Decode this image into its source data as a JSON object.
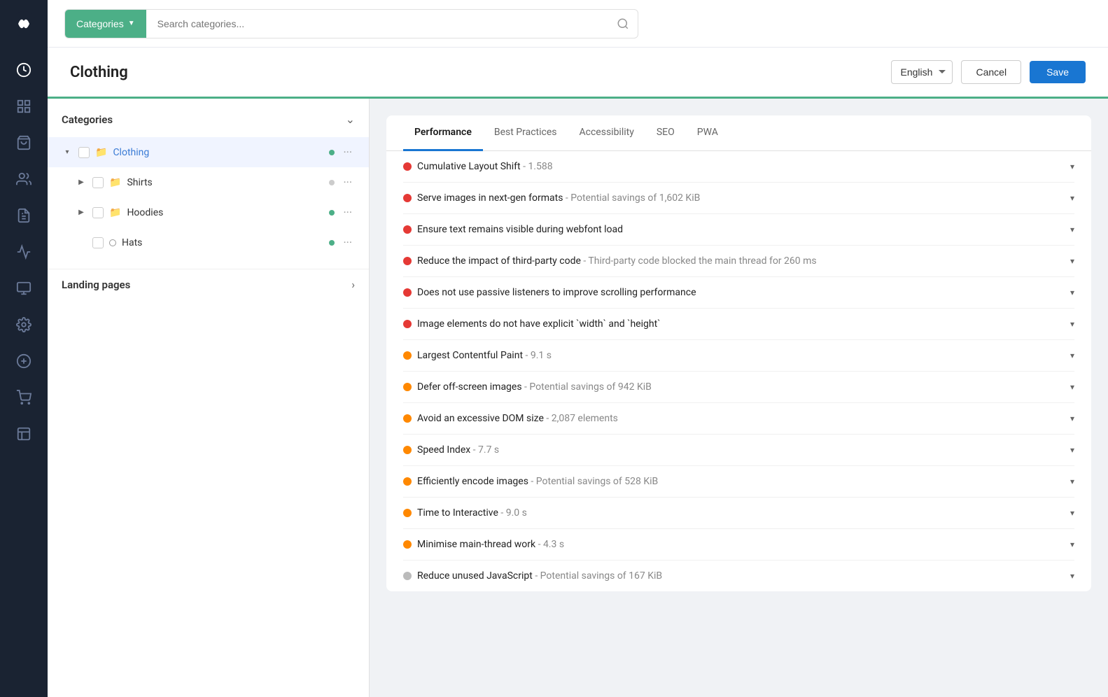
{
  "sidebar": {
    "logo_alt": "Ced Commerce Logo",
    "nav_items": [
      {
        "name": "dashboard",
        "icon": "chart-circle"
      },
      {
        "name": "catalog",
        "icon": "grid"
      },
      {
        "name": "products",
        "icon": "shopping-bag"
      },
      {
        "name": "users",
        "icon": "users"
      },
      {
        "name": "orders",
        "icon": "clipboard"
      },
      {
        "name": "promotions",
        "icon": "megaphone"
      },
      {
        "name": "integrations",
        "icon": "puzzle"
      },
      {
        "name": "settings",
        "icon": "gear"
      },
      {
        "name": "add",
        "icon": "plus-circle"
      },
      {
        "name": "cart",
        "icon": "cart"
      },
      {
        "name": "analytics",
        "icon": "bar-chart"
      }
    ]
  },
  "topbar": {
    "categories_btn": "Categories",
    "search_placeholder": "Search categories...",
    "search_icon": "search"
  },
  "page_header": {
    "title": "Clothing",
    "language": "English",
    "cancel_label": "Cancel",
    "save_label": "Save"
  },
  "left_panel": {
    "categories_section": "Categories",
    "tree": [
      {
        "label": "Clothing",
        "level": 0,
        "expanded": true,
        "is_folder": true,
        "status": "green",
        "selected": true
      },
      {
        "label": "Shirts",
        "level": 1,
        "expanded": false,
        "is_folder": true,
        "status": "gray",
        "selected": false
      },
      {
        "label": "Hoodies",
        "level": 1,
        "expanded": false,
        "is_folder": true,
        "status": "green",
        "selected": false
      },
      {
        "label": "Hats",
        "level": 1,
        "expanded": false,
        "is_folder": false,
        "status": "green",
        "selected": false
      }
    ],
    "landing_pages": "Landing pages"
  },
  "right_panel": {
    "tabs": [
      {
        "label": "Performance",
        "active": true
      },
      {
        "label": "Best Practices",
        "active": false
      },
      {
        "label": "Accessibility",
        "active": false
      },
      {
        "label": "SEO",
        "active": false
      },
      {
        "label": "PWA",
        "active": false
      }
    ],
    "metrics": [
      {
        "dot_color": "red",
        "text": "Cumulative Layout Shift",
        "detail": "- 1.588",
        "has_chevron": true
      },
      {
        "dot_color": "red",
        "text": "Serve images in next-gen formats",
        "detail": "- Potential savings of 1,602 KiB",
        "has_chevron": true
      },
      {
        "dot_color": "red",
        "text": "Ensure text remains visible during webfont load",
        "detail": "",
        "has_chevron": true
      },
      {
        "dot_color": "red",
        "text": "Reduce the impact of third-party code",
        "detail": "- Third-party code blocked the main thread for 260 ms",
        "has_chevron": true
      },
      {
        "dot_color": "red",
        "text": "Does not use passive listeners to improve scrolling performance",
        "detail": "",
        "has_chevron": true
      },
      {
        "dot_color": "red",
        "text": "Image elements do not have explicit `width` and `height`",
        "detail": "",
        "has_chevron": true
      },
      {
        "dot_color": "orange",
        "text": "Largest Contentful Paint",
        "detail": "- 9.1 s",
        "has_chevron": true
      },
      {
        "dot_color": "orange",
        "text": "Defer off-screen images",
        "detail": "- Potential savings of 942 KiB",
        "has_chevron": true
      },
      {
        "dot_color": "orange",
        "text": "Avoid an excessive DOM size",
        "detail": "- 2,087 elements",
        "has_chevron": true
      },
      {
        "dot_color": "orange",
        "text": "Speed Index",
        "detail": "- 7.7 s",
        "has_chevron": true
      },
      {
        "dot_color": "orange",
        "text": "Efficiently encode images",
        "detail": "- Potential savings of 528 KiB",
        "has_chevron": true
      },
      {
        "dot_color": "orange",
        "text": "Time to Interactive",
        "detail": "- 9.0 s",
        "has_chevron": true
      },
      {
        "dot_color": "orange",
        "text": "Minimise main-thread work",
        "detail": "- 4.3 s",
        "has_chevron": true
      },
      {
        "dot_color": "gray",
        "text": "Reduce unused JavaScript",
        "detail": "- Potential savings of 167 KiB",
        "has_chevron": true
      }
    ]
  }
}
